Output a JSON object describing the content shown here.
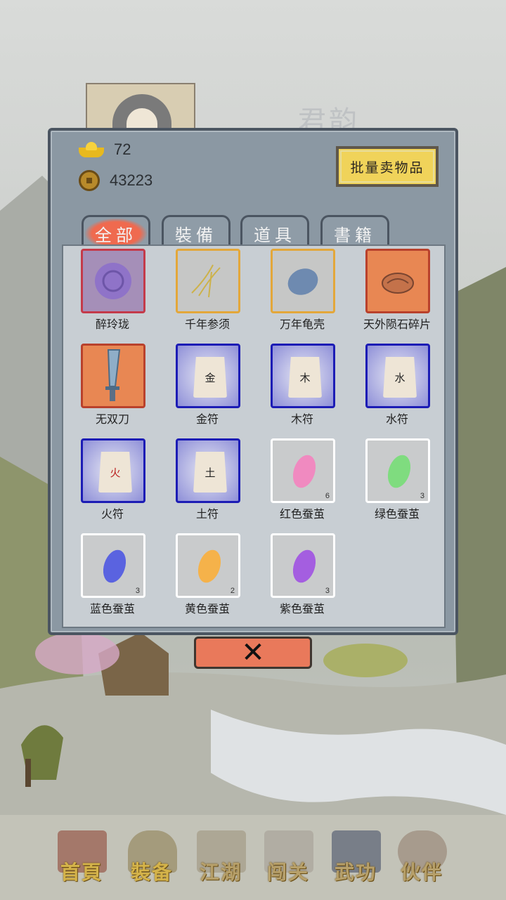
{
  "background": {
    "character_name": "君韵"
  },
  "currency": {
    "ingot": "72",
    "coins": "43223"
  },
  "sell_button": "批量卖物品",
  "tabs": [
    {
      "label": "全部",
      "active": true
    },
    {
      "label": "裝備",
      "active": false
    },
    {
      "label": "道具",
      "active": false
    },
    {
      "label": "書籍",
      "active": false
    }
  ],
  "items": [
    {
      "name": "醉玲珑",
      "quality": "purple",
      "icon": "jade-disc-icon",
      "count": ""
    },
    {
      "name": "千年参须",
      "quality": "gold",
      "icon": "ginseng-icon",
      "count": ""
    },
    {
      "name": "万年龟壳",
      "quality": "gold",
      "icon": "turtle-shell-icon",
      "count": ""
    },
    {
      "name": "天外陨石碎片",
      "quality": "orange",
      "icon": "meteorite-icon",
      "count": ""
    },
    {
      "name": "无双刀",
      "quality": "orange",
      "icon": "broadsword-icon",
      "count": ""
    },
    {
      "name": "金符",
      "quality": "blue",
      "icon": "talisman-icon",
      "glyph": "金",
      "count": ""
    },
    {
      "name": "木符",
      "quality": "blue",
      "icon": "talisman-icon",
      "glyph": "木",
      "count": ""
    },
    {
      "name": "水符",
      "quality": "blue",
      "icon": "talisman-icon",
      "glyph": "水",
      "count": ""
    },
    {
      "name": "火符",
      "quality": "blue",
      "icon": "talisman-icon",
      "glyph": "火",
      "count": ""
    },
    {
      "name": "土符",
      "quality": "blue",
      "icon": "talisman-icon",
      "glyph": "土",
      "count": ""
    },
    {
      "name": "红色蚕茧",
      "quality": "white",
      "icon": "cocoon-icon",
      "color": "#f08ac0",
      "count": "6"
    },
    {
      "name": "绿色蚕茧",
      "quality": "white",
      "icon": "cocoon-icon",
      "color": "#7fdc7f",
      "count": "3"
    },
    {
      "name": "蓝色蚕茧",
      "quality": "white",
      "icon": "cocoon-icon",
      "color": "#5a63e0",
      "count": "3"
    },
    {
      "name": "黄色蚕茧",
      "quality": "white",
      "icon": "cocoon-icon",
      "color": "#f5b24a",
      "count": "2"
    },
    {
      "name": "紫色蚕茧",
      "quality": "white",
      "icon": "cocoon-icon",
      "color": "#a45ee0",
      "count": "3"
    }
  ],
  "close_button": "✕",
  "nav": [
    {
      "label": "首頁",
      "icon": "house-icon"
    },
    {
      "label": "裝备",
      "icon": "armor-icon"
    },
    {
      "label": "江湖",
      "icon": "scroll-icon"
    },
    {
      "label": "闯关",
      "icon": "swords-icon"
    },
    {
      "label": "武功",
      "icon": "book-icon"
    },
    {
      "label": "伙伴",
      "icon": "companions-icon"
    }
  ]
}
